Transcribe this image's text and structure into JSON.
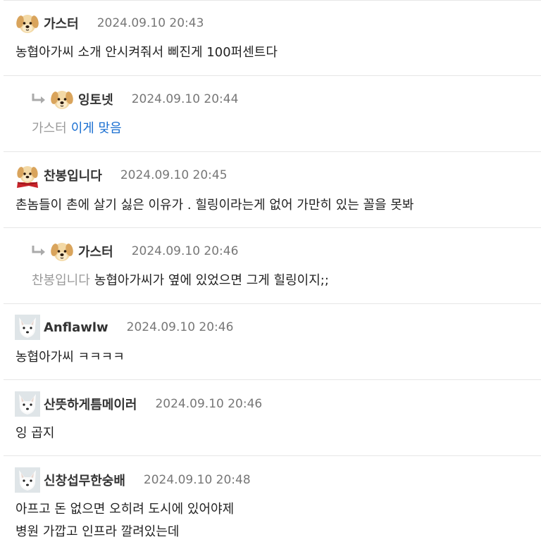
{
  "comments": [
    {
      "nick": "가스터",
      "date": "2024.09.10 20:43",
      "avatar": "golden-puppy-icon",
      "text": "농협아가씨 소개 안시켜줘서 삐진게 100퍼센트다"
    },
    {
      "nick": "잉토넷",
      "date": "2024.09.10 20:44",
      "avatar": "golden-puppy-icon",
      "reply": true,
      "mention": "가스터",
      "text": "이게 맞음",
      "text_color": "#1a6fd1"
    },
    {
      "nick": "찬봉입니다",
      "date": "2024.09.10 20:45",
      "avatar": "puppy-with-red-scarf-icon",
      "text": "촌놈들이 촌에 살기 싫은 이유가 . 힐링이라는게 없어 가만히 있는 꼴을 못봐"
    },
    {
      "nick": "가스터",
      "date": "2024.09.10 20:46",
      "avatar": "golden-puppy-icon",
      "reply": true,
      "mention": "찬봉입니다",
      "text": "농협아가씨가 옆에 있었으면 그게 힐링이지;;"
    },
    {
      "nick": "Anflawlw",
      "date": "2024.09.10 20:46",
      "avatar": "white-fox-icon",
      "text": "농협아가씨 ㅋㅋㅋㅋ"
    },
    {
      "nick": "산뜻하게틈메이러",
      "date": "2024.09.10 20:46",
      "avatar": "white-fox-icon",
      "text": "잉 곱지"
    },
    {
      "nick": "신창섭무한숭배",
      "date": "2024.09.10 20:48",
      "avatar": "white-fox-icon",
      "text": "아프고 돈 없으면 오히려 도시에 있어야제",
      "text2": "병원 가깝고 인프라 깔려있는데"
    }
  ]
}
